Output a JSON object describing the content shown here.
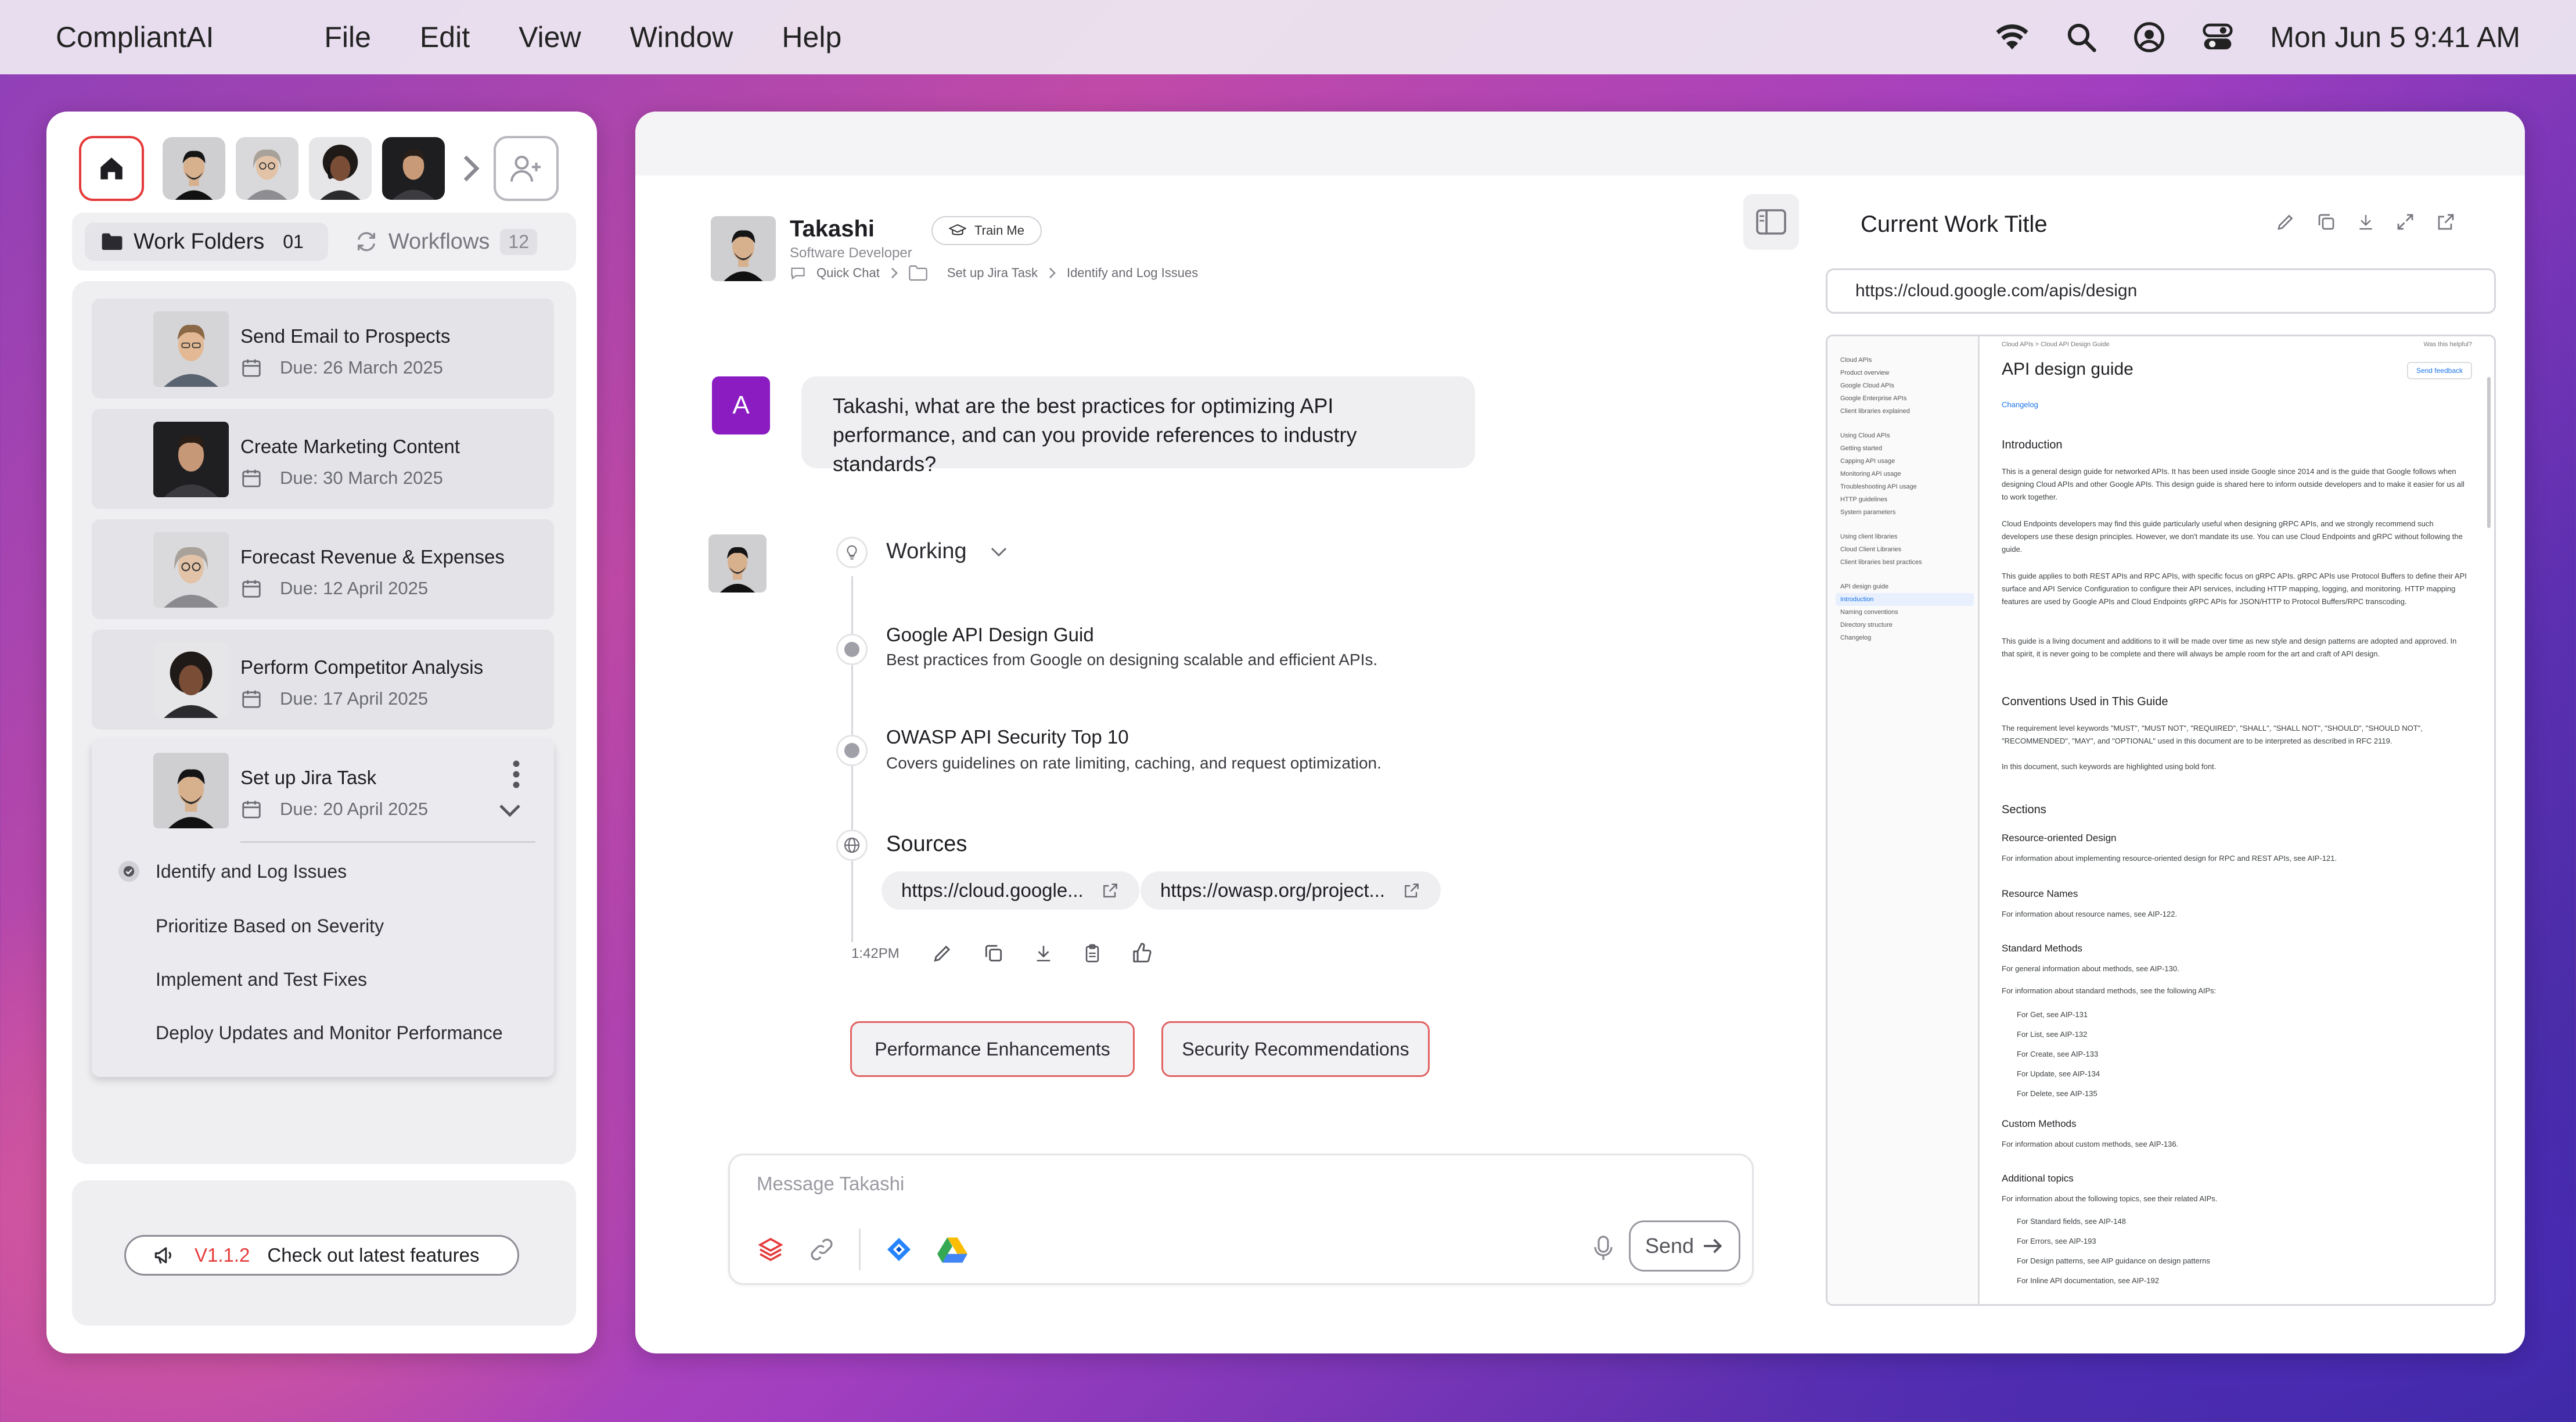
{
  "menubar": {
    "app_name": "CompliantAI",
    "menus": [
      "File",
      "Edit",
      "View",
      "Window",
      "Help"
    ],
    "datetime": "Mon Jun 5  9:41 AM"
  },
  "left": {
    "tabs": [
      {
        "label": "Work Folders",
        "count": "01"
      },
      {
        "label": "Workflows",
        "count": "12"
      }
    ],
    "tasks": [
      {
        "title": "Send Email to Prospects",
        "due": "Due: 26 March 2025"
      },
      {
        "title": "Create Marketing Content",
        "due": "Due: 30 March 2025"
      },
      {
        "title": "Forecast Revenue & Expenses",
        "due": "Due: 12 April 2025"
      },
      {
        "title": "Perform Competitor Analysis",
        "due": "Due: 17 April 2025"
      },
      {
        "title": "Set up Jira Task",
        "due": "Due: 20 April 2025"
      }
    ],
    "subtasks": [
      "Identify and Log Issues",
      "Prioritize Based on Severity",
      "Implement and Test Fixes",
      "Deploy Updates and Monitor Performance"
    ],
    "version": "V1.1.2",
    "version_cta": "Check out latest features"
  },
  "chat": {
    "agent_name": "Takashi",
    "agent_role": "Software Developer",
    "train_label": "Train Me",
    "crumbs": [
      "Quick Chat",
      "Set up Jira Task",
      "Identify and Log Issues"
    ],
    "user_initial": "A",
    "user_message": "Takashi, what are the best practices for optimizing API performance, and can you provide references to industry standards?",
    "working_label": "Working",
    "steps": [
      {
        "title": "Google API Design Guid",
        "desc": "Best practices from Google on designing scalable and efficient APIs."
      },
      {
        "title": "OWASP API Security Top 10",
        "desc": "Covers guidelines on rate limiting, caching, and request optimization."
      }
    ],
    "sources_label": "Sources",
    "sources": [
      "https://cloud.google...",
      "https://owasp.org/project..."
    ],
    "time": "1:42PM",
    "chips": [
      "Performance Enhancements",
      "Security Recommendations"
    ],
    "composer_placeholder": "Message Takashi",
    "send_label": "Send"
  },
  "work": {
    "title": "Current Work Title",
    "url": "https://cloud.google.com/apis/design",
    "preview": {
      "nav_groups": [
        [
          "Cloud APIs",
          "Product overview",
          "Google Cloud APIs",
          "Google Enterprise APIs",
          "Client libraries explained"
        ],
        [
          "Using Cloud APIs",
          "Getting started",
          "Capping API usage",
          "Monitoring API usage",
          "Troubleshooting API usage",
          "HTTP guidelines",
          "System parameters"
        ],
        [
          "Using client libraries",
          "Cloud Client Libraries",
          "Client libraries best practices"
        ],
        [
          "API design guide",
          "Introduction",
          "Naming conventions",
          "Directory structure",
          "Changelog"
        ]
      ],
      "crumb": "Cloud APIs  >  Cloud API Design Guide",
      "helpful": "Was this helpful?",
      "h1": "API design guide",
      "feedback": "Send feedback",
      "changelog": "Changelog",
      "intro_h": "Introduction",
      "intro_p1": "This is a general design guide for networked APIs. It has been used inside Google since 2014 and is the guide that Google follows when designing Cloud APIs and other Google APIs. This design guide is shared here to inform outside developers and to make it easier for us all to work together.",
      "intro_p2": "Cloud Endpoints developers may find this guide particularly useful when designing gRPC APIs, and we strongly recommend such developers use these design principles. However, we don't mandate its use. You can use Cloud Endpoints and gRPC without following the guide.",
      "intro_p3": "This guide applies to both REST APIs and RPC APIs, with specific focus on gRPC APIs. gRPC APIs use Protocol Buffers to define their API surface and API Service Configuration to configure their API services, including HTTP mapping, logging, and monitoring. HTTP mapping features are used by Google APIs and Cloud Endpoints gRPC APIs for JSON/HTTP to Protocol Buffers/RPC transcoding.",
      "intro_p4": "This guide is a living document and additions to it will be made over time as new style and design patterns are adopted and approved. In that spirit, it is never going to be complete and there will always be ample room for the art and craft of API design.",
      "conv_h": "Conventions Used in This Guide",
      "conv_p1": "The requirement level keywords \"MUST\", \"MUST NOT\", \"REQUIRED\", \"SHALL\", \"SHALL NOT\", \"SHOULD\", \"SHOULD NOT\", \"RECOMMENDED\", \"MAY\", and \"OPTIONAL\" used in this document are to be interpreted as described in RFC 2119.",
      "conv_p2": "In this document, such keywords are highlighted using bold font.",
      "sections_h": "Sections",
      "sec1_h": "Resource-oriented Design",
      "sec1_p": "For information about implementing resource-oriented design for RPC and REST APIs, see AIP-121.",
      "sec2_h": "Resource Names",
      "sec2_p": "For information about resource names, see AIP-122.",
      "sec3_h": "Standard Methods",
      "sec3_p1": "For general information about methods, see AIP-130.",
      "sec3_p2": "For information about standard methods, see the following AIPs:",
      "sec3_list": [
        "For Get, see AIP-131",
        "For List, see AIP-132",
        "For Create, see AIP-133",
        "For Update, see AIP-134",
        "For Delete, see AIP-135"
      ],
      "sec4_h": "Custom Methods",
      "sec4_p": "For information about custom methods, see AIP-136.",
      "sec5_h": "Additional topics",
      "sec5_p": "For information about the following topics, see their related AIPs.",
      "sec5_list": [
        "For Standard fields, see AIP-148",
        "For Errors, see AIP-193",
        "For Design patterns, see AIP guidance on design patterns",
        "For Inline API documentation, see AIP-192"
      ]
    }
  },
  "colors": {
    "accent_red": "#e53a3a",
    "user_avatar": "#8a1cc2",
    "link_blue": "#1a73e8"
  }
}
